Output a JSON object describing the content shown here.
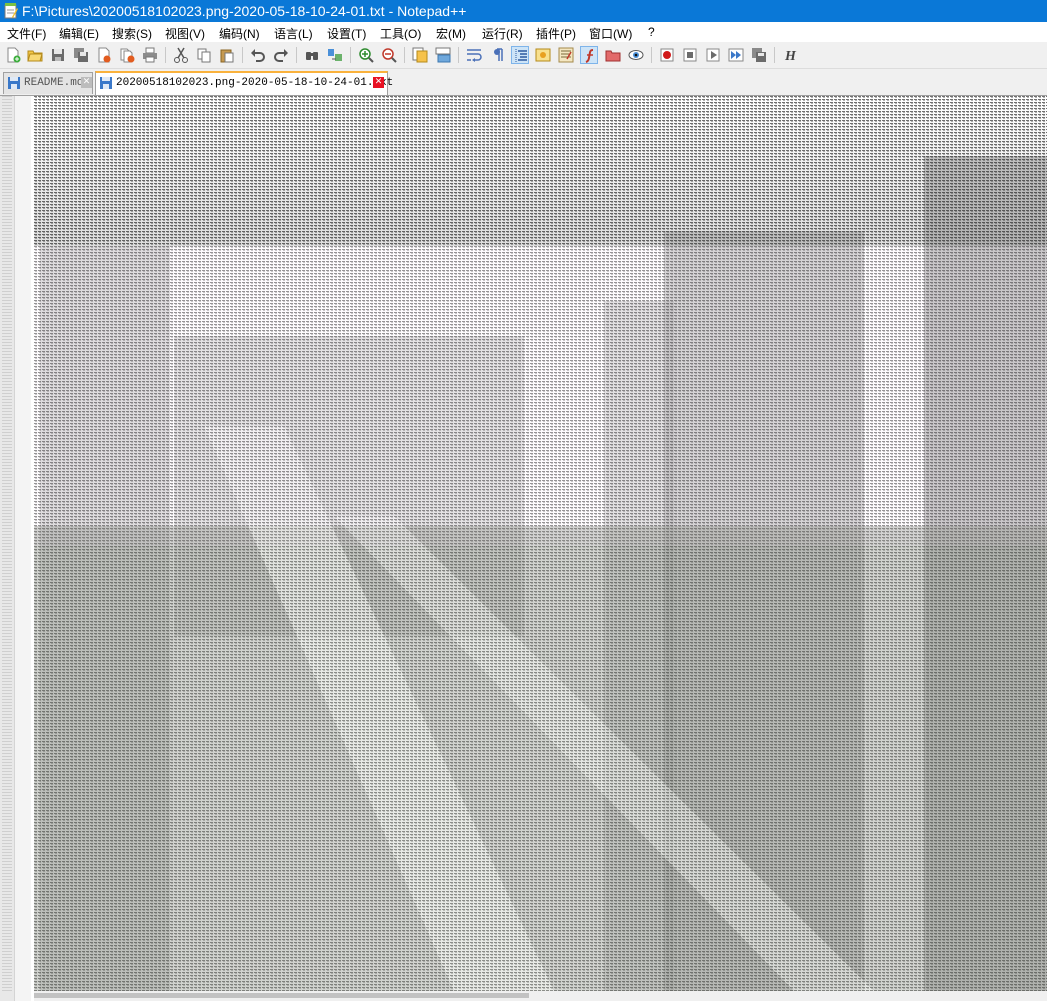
{
  "window": {
    "title": "F:\\Pictures\\20200518102023.png-2020-05-18-10-24-01.txt - Notepad++",
    "accent": "#0a78d7"
  },
  "menu": [
    {
      "id": "file",
      "label": "文件(F)"
    },
    {
      "id": "edit",
      "label": "编辑(E)"
    },
    {
      "id": "search",
      "label": "搜索(S)"
    },
    {
      "id": "view",
      "label": "视图(V)"
    },
    {
      "id": "encoding",
      "label": "编码(N)"
    },
    {
      "id": "language",
      "label": "语言(L)"
    },
    {
      "id": "settings",
      "label": "设置(T)"
    },
    {
      "id": "tools",
      "label": "工具(O)"
    },
    {
      "id": "macro",
      "label": "宏(M)"
    },
    {
      "id": "run",
      "label": "运行(R)"
    },
    {
      "id": "plugins",
      "label": "插件(P)"
    },
    {
      "id": "window",
      "label": "窗口(W)"
    },
    {
      "id": "help",
      "label": "?"
    }
  ],
  "toolbar": [
    {
      "icon": "new-file-icon"
    },
    {
      "icon": "open-file-icon"
    },
    {
      "icon": "save-icon"
    },
    {
      "icon": "save-all-icon"
    },
    {
      "icon": "close-icon"
    },
    {
      "icon": "close-all-icon"
    },
    {
      "icon": "print-icon"
    },
    {
      "icon": "cut-icon"
    },
    {
      "icon": "copy-icon"
    },
    {
      "icon": "paste-icon"
    },
    {
      "icon": "undo-icon"
    },
    {
      "icon": "redo-icon"
    },
    {
      "icon": "find-icon"
    },
    {
      "icon": "replace-icon"
    },
    {
      "icon": "zoom-in-icon"
    },
    {
      "icon": "zoom-out-icon"
    },
    {
      "icon": "sync-vertical-icon"
    },
    {
      "icon": "sync-horizontal-icon"
    },
    {
      "icon": "word-wrap-icon"
    },
    {
      "icon": "show-all-characters-icon"
    },
    {
      "icon": "indent-guide-icon"
    },
    {
      "icon": "user-defined-language-icon"
    },
    {
      "icon": "document-map-icon"
    },
    {
      "icon": "function-list-icon"
    },
    {
      "icon": "folder-as-workspace-icon"
    },
    {
      "icon": "monitoring-icon"
    },
    {
      "icon": "record-macro-icon"
    },
    {
      "icon": "stop-recording-icon"
    },
    {
      "icon": "playback-icon"
    },
    {
      "icon": "run-macro-multiple-icon"
    },
    {
      "icon": "save-macro-icon"
    },
    {
      "icon": "hex-editor-icon"
    }
  ],
  "tabs": [
    {
      "label": "README.md",
      "active": false
    },
    {
      "label": "20200518102023.png-2020-05-18-10-24-01.txt",
      "active": true
    }
  ],
  "editor": {
    "content_description": ""
  }
}
